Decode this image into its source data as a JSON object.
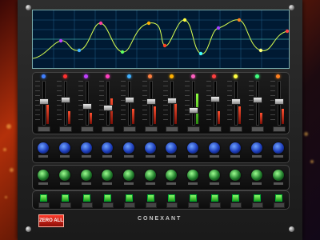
{
  "buttons": {
    "zero_all": "ZERO ALL"
  },
  "brand": "CONEXANT",
  "eq_graph": {
    "point_colors": [
      "#c040ff",
      "#40b0ff",
      "#ff40a0",
      "#60ff60",
      "#ffb000",
      "#ff4020",
      "#ffff40",
      "#40ffff",
      "#a040ff",
      "#ff8020",
      "#ffff80",
      "#ff4040"
    ]
  },
  "bands": [
    {
      "button_color": "#4080ff",
      "level": 0.45,
      "slider_value": 0.55
    },
    {
      "button_color": "#ff3030",
      "level": 0.3,
      "slider_value": 0.6
    },
    {
      "button_color": "#c040ff",
      "level": 0.25,
      "slider_value": 0.45
    },
    {
      "button_color": "#ff40c0",
      "level": 0.6,
      "slider_value": 0.4
    },
    {
      "button_color": "#40b0ff",
      "level": 0.35,
      "slider_value": 0.6
    },
    {
      "button_color": "#ff8040",
      "level": 0.4,
      "slider_value": 0.55
    },
    {
      "button_color": "#ffb000",
      "level": 0.5,
      "slider_value": 0.58
    },
    {
      "button_color": "#ff60c0",
      "level": 0.7,
      "slider_value": 0.35
    },
    {
      "button_color": "#ff4040",
      "level": 0.3,
      "slider_value": 0.62
    },
    {
      "button_color": "#ffff40",
      "level": 0.4,
      "slider_value": 0.55
    },
    {
      "button_color": "#40ff80",
      "level": 0.25,
      "slider_value": 0.6
    },
    {
      "button_color": "#ff8020",
      "level": 0.35,
      "slider_value": 0.55
    }
  ]
}
